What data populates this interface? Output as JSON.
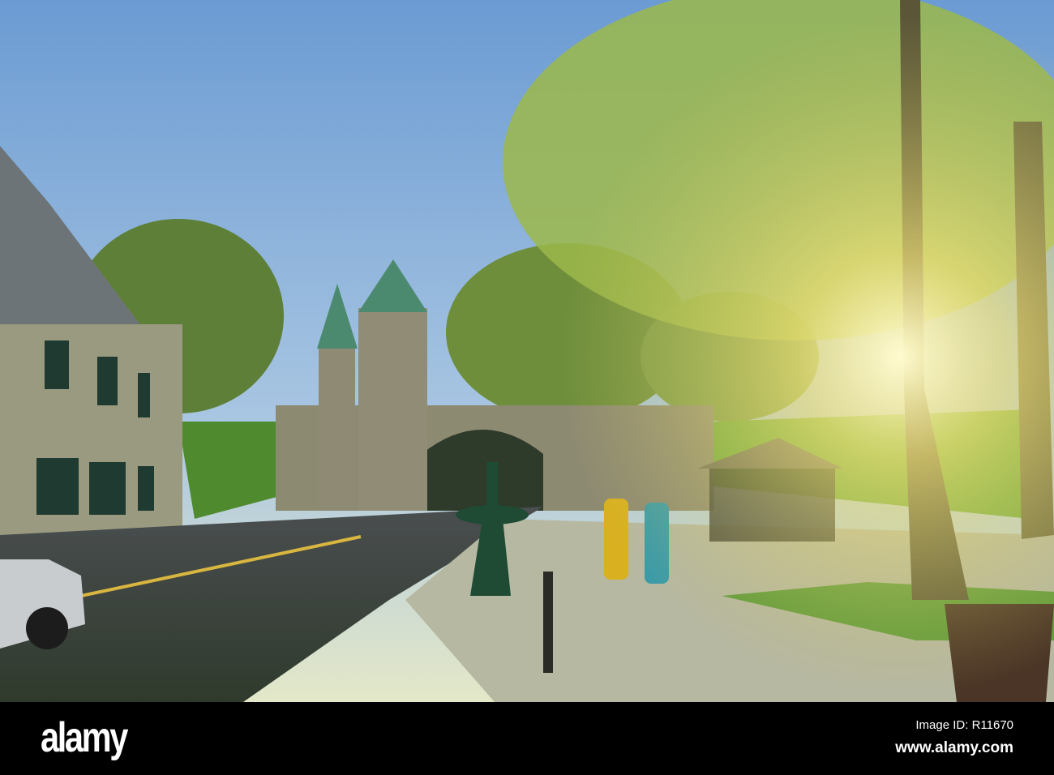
{
  "photo": {
    "subject": "city gate street scene at sunset"
  },
  "watermark": {
    "logo": "alamy",
    "image_id": "Image ID: R11670",
    "url": "www.alamy.com"
  },
  "colors": {
    "sky_top": "#6f9fd6",
    "sky_low": "#c9dcea",
    "grass": "#5f9a3a",
    "sun": "#fff6b0"
  }
}
